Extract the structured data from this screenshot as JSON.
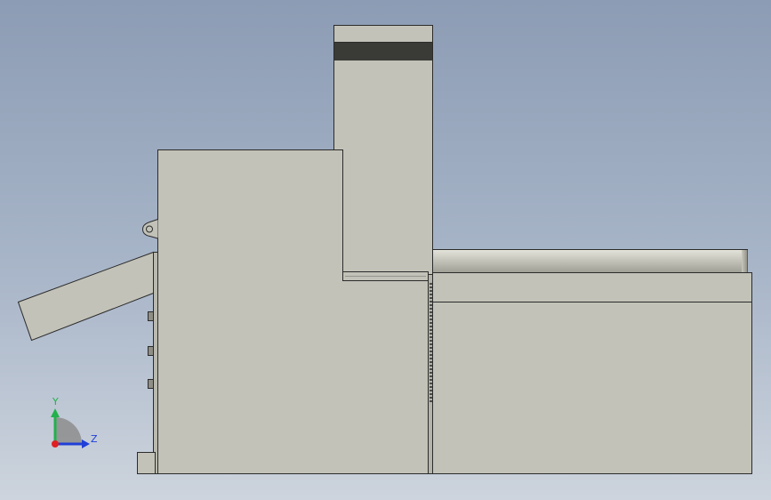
{
  "colors": {
    "body_fill": "#c2c2b8",
    "body_fill_light": "#c9c9bf",
    "edge": "#2b2b2b",
    "dark_band": "#3a3b36",
    "axis_y": "#22b14c",
    "axis_z": "#1f3fd8",
    "axis_origin": "#e02020"
  },
  "triad": {
    "y_label": "Y",
    "z_label": "Z"
  }
}
